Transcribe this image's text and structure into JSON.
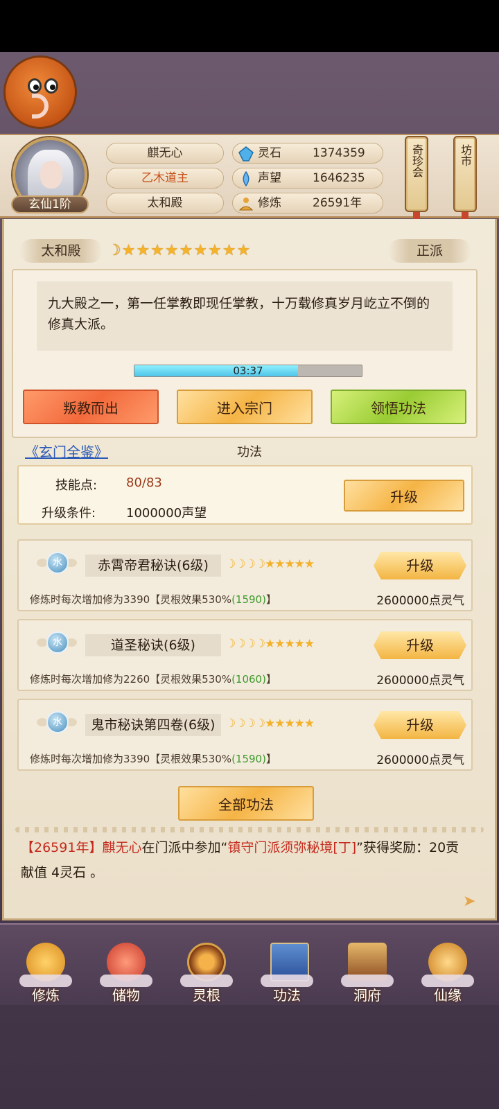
{
  "header": {
    "player_name": "麒无心",
    "title": "乙木道主",
    "sect": "太和殿",
    "rank": "玄仙1阶",
    "stats": [
      {
        "icon": "spirit-stone-icon",
        "label": "灵石",
        "value": "1374359"
      },
      {
        "icon": "reputation-icon",
        "label": "声望",
        "value": "1646235"
      },
      {
        "icon": "meditation-icon",
        "label": "修炼",
        "value": "26591年"
      }
    ],
    "lanterns": [
      "奇珍会",
      "坊市"
    ]
  },
  "sect_panel": {
    "name": "太和殿",
    "alignment": "正派",
    "description": "九大殿之一，第一任掌教即现任掌教，十万载修真岁月屹立不倒的修真大派。",
    "timer": "03:37",
    "timer_progress": 0.72,
    "buttons": [
      "叛教而出",
      "进入宗门",
      "领悟功法"
    ]
  },
  "gongfa": {
    "link": "《玄门全鉴》",
    "section_title": "功法",
    "skill_points_label": "技能点:",
    "skill_points": "80/83",
    "upgrade_cond_label": "升级条件:",
    "upgrade_cond": "1000000声望",
    "upgrade_button": "升级",
    "items": [
      {
        "element": "水",
        "name": "赤霄帝君秘诀(6级)",
        "moons": "☽☽☽☽★★★★★",
        "button": "升级",
        "desc_prefix": "修炼时每次增加修为3390【灵根效果530%",
        "desc_bonus": "(1590)",
        "desc_suffix": "】",
        "cost": "2600000点灵气"
      },
      {
        "element": "水",
        "name": "道圣秘诀(6级)",
        "moons": "☽☽☽☽★★★★★",
        "button": "升级",
        "desc_prefix": "修炼时每次增加修为2260【灵根效果530%",
        "desc_bonus": "(1060)",
        "desc_suffix": "】",
        "cost": "2600000点灵气"
      },
      {
        "element": "水",
        "name": "鬼市秘诀第四卷(6级)",
        "moons": "☽☽☽☽★★★★★",
        "button": "升级",
        "desc_prefix": "修炼时每次增加修为3390【灵根效果530%",
        "desc_bonus": "(1590)",
        "desc_suffix": "】",
        "cost": "2600000点灵气"
      }
    ],
    "all_button": "全部功法"
  },
  "log": {
    "year": "【26591年】",
    "name": "麒无心",
    "mid": "在门派中参加“",
    "event": "镇守门派须弥秘境[丁]",
    "after": "”获得奖励：20贡献值 4灵石 。"
  },
  "nav": [
    "修炼",
    "储物",
    "灵根",
    "功法",
    "洞府",
    "仙缘"
  ],
  "colors": {
    "accent_gold": "#f5b445",
    "link_blue": "#2a5ab8",
    "log_red": "#c42b1e",
    "bonus_green": "#3d9a2b"
  }
}
